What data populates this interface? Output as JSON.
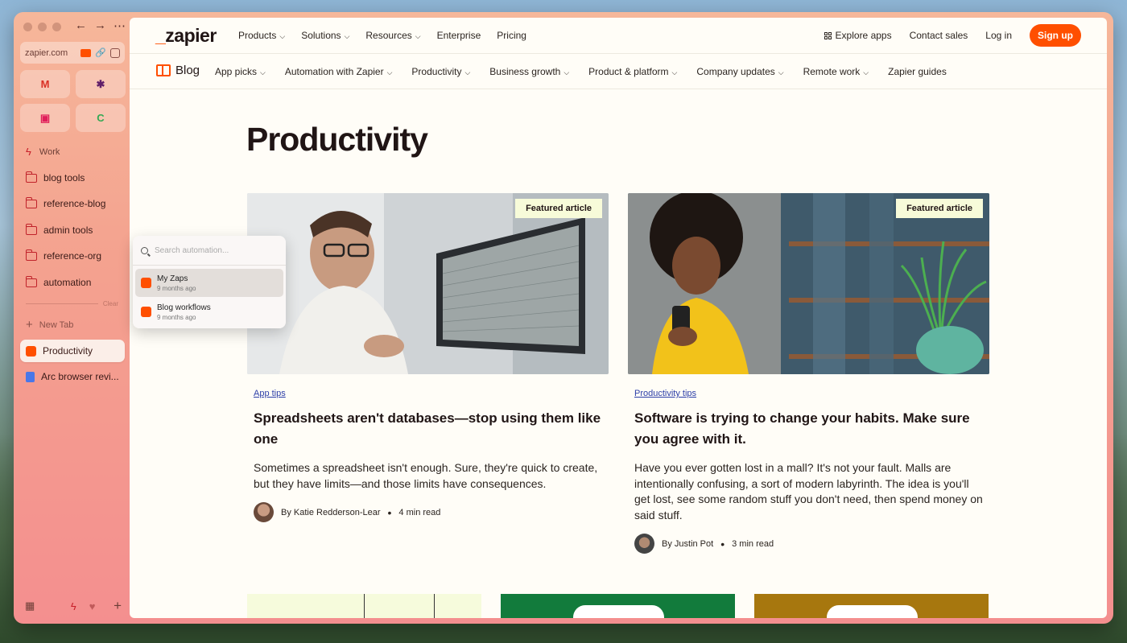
{
  "sidebar": {
    "url": "zapier.com",
    "favorites": [
      {
        "icon": "gmail-icon",
        "glyph": "M",
        "color": "#d93025"
      },
      {
        "icon": "slack-icon",
        "glyph": "✱",
        "color": "#611f69"
      },
      {
        "icon": "calendar-icon",
        "glyph": "▣",
        "color": "#e01e5a"
      },
      {
        "icon": "chrome-icon",
        "glyph": "C",
        "color": "#34a853"
      }
    ],
    "space_label": "Work",
    "folders": [
      "blog tools",
      "reference-blog",
      "admin tools",
      "reference-org",
      "automation"
    ],
    "clear_label": "Clear",
    "new_tab": "New Tab",
    "tabs": [
      {
        "label": "Productivity",
        "active": true
      },
      {
        "label": "Arc browser revi...",
        "active": false
      }
    ]
  },
  "popup": {
    "placeholder": "Search automation...",
    "items": [
      {
        "title": "My Zaps",
        "subtitle": "9 months ago"
      },
      {
        "title": "Blog workflows",
        "subtitle": "9 months ago"
      }
    ]
  },
  "topnav": {
    "logo_mark": "_",
    "logo_text": "zapier",
    "links": [
      "Products",
      "Solutions",
      "Resources",
      "Enterprise",
      "Pricing"
    ],
    "explore": "Explore apps",
    "contact": "Contact sales",
    "login": "Log in",
    "signup": "Sign up"
  },
  "blognav": {
    "label": "Blog",
    "links": [
      "App picks",
      "Automation with Zapier",
      "Productivity",
      "Business growth",
      "Product & platform",
      "Company updates",
      "Remote work",
      "Zapier guides"
    ]
  },
  "page": {
    "title": "Productivity",
    "cards": [
      {
        "badge": "Featured article",
        "tag": "App tips",
        "title": "Spreadsheets aren't databases—stop using them like one",
        "desc": "Sometimes a spreadsheet isn't enough. Sure, they're quick to create, but they have limits—and those limits have consequences.",
        "author": "By Katie Redderson-Lear",
        "read": "4 min read"
      },
      {
        "badge": "Featured article",
        "tag": "Productivity tips",
        "title": "Software is trying to change your habits. Make sure you agree with it.",
        "desc": "Have you ever gotten lost in a mall? It's not your fault. Malls are intentionally confusing, a sort of modern labyrinth. The idea is you'll get lost, see some random stuff you don't need, then spend money on said stuff.",
        "author": "By Justin Pot",
        "read": "3 min read"
      }
    ]
  },
  "colors": {
    "brand": "#ff4f00",
    "tile_1": "#f6fbdc",
    "tile_2": "#127b3c",
    "tile_3": "#a7770e"
  }
}
